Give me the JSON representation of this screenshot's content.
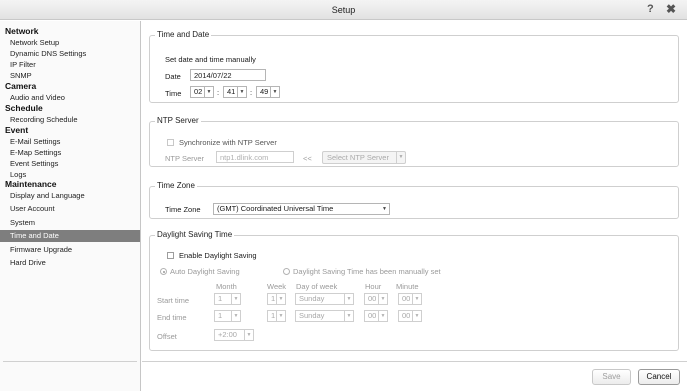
{
  "window": {
    "title": "Setup",
    "help_icon": "question-icon",
    "close_icon": "close-icon"
  },
  "sidebar": {
    "sections": [
      {
        "label": "Network",
        "items": [
          "Network Setup",
          "Dynamic DNS Settings",
          "IP Filter",
          "SNMP"
        ]
      },
      {
        "label": "Camera",
        "items": [
          "Audio and Video"
        ]
      },
      {
        "label": "Schedule",
        "items": [
          "Recording Schedule"
        ]
      },
      {
        "label": "Event",
        "items": [
          "E-Mail Settings",
          "E-Map Settings",
          "Event Settings",
          "Logs"
        ]
      },
      {
        "label": "Maintenance",
        "items": [
          "Display and Language",
          "User Account",
          "System",
          "Time and Date",
          "Firmware Upgrade",
          "Hard Drive"
        ]
      }
    ],
    "active_item": "Time and Date"
  },
  "time_and_date": {
    "legend": "Time and Date",
    "manual_label": "Set date and time manually",
    "date_label": "Date",
    "date_value": "2014/07/22",
    "time_label": "Time",
    "hour": "02",
    "minute": "41",
    "second": "49",
    "separator": ":"
  },
  "ntp": {
    "legend": "NTP Server",
    "sync_label": "Synchronize with NTP Server",
    "server_label": "NTP Server",
    "server_placeholder": "ntp1.dlink.com",
    "arrow_text": "<<",
    "select_button": "Select NTP Server"
  },
  "time_zone": {
    "legend": "Time Zone",
    "label": "Time Zone",
    "value": "(GMT) Coordinated Universal Time"
  },
  "dst": {
    "legend": "Daylight Saving Time",
    "enable_label": "Enable Daylight Saving",
    "auto_label": "Auto Daylight Saving",
    "manual_label": "Daylight Saving Time has been manually set",
    "col_month": "Month",
    "col_week": "Week",
    "col_day": "Day of week",
    "col_hour": "Hour",
    "col_minute": "Minute",
    "start_label": "Start time",
    "end_label": "End time",
    "start": {
      "month": "1",
      "week": "1",
      "day": "Sunday",
      "hour": "00",
      "minute": "00"
    },
    "end": {
      "month": "1",
      "week": "1",
      "day": "Sunday",
      "hour": "00",
      "minute": "00"
    },
    "offset_label": "Offset",
    "offset_value": "+2:00"
  },
  "footer": {
    "save": "Save",
    "cancel": "Cancel"
  },
  "colors": {
    "active_item_bg": "#7e7e7e",
    "disabled_text": "#9a9a9a"
  }
}
